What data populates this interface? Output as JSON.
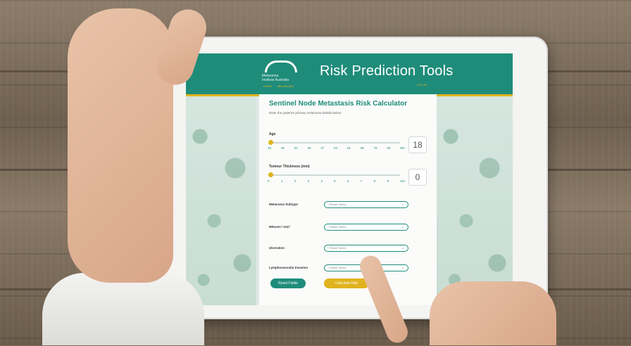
{
  "app": {
    "title": "Risk Prediction Tools",
    "logo_text_line1": "Melanoma",
    "logo_text_line2": "Institute Australia",
    "nav": [
      "HOME",
      "MELANOMA"
    ],
    "login": "LOG IN"
  },
  "card": {
    "title": "Sentinel Node Metastasis Risk Calculator",
    "subtitle": "Enter the patient's primary melanoma details below:"
  },
  "age": {
    "label": "Age",
    "ticks": [
      "18",
      "25",
      "32",
      "40",
      "47",
      "54",
      "61",
      "68",
      "76",
      "83",
      "90+"
    ],
    "value": "18",
    "slider_fraction": 0.0
  },
  "thickness": {
    "label": "Tumour Thickness (mm)",
    "ticks": [
      "0",
      "1",
      "2",
      "3",
      "4",
      "5",
      "6",
      "7",
      "8",
      "9",
      "10+"
    ],
    "value": "0",
    "slider_fraction": 0.0
  },
  "selects": [
    {
      "label": "Melanoma Subtype",
      "placeholder": "Please Select"
    },
    {
      "label": "Mitoses / mm²",
      "placeholder": "Please Select"
    },
    {
      "label": "Ulceration",
      "placeholder": "Please Select"
    },
    {
      "label": "Lymphovascular Invasion",
      "placeholder": "Please Select"
    }
  ],
  "buttons": {
    "reset": "Reset Fields",
    "calculate": "Calculate Risk"
  },
  "colors": {
    "brand_teal": "#1f8c7a",
    "accent_gold": "#e0b31e"
  },
  "icons": {
    "select_arrow": "chevron-down-icon",
    "logo": "logo-arc-icon"
  }
}
